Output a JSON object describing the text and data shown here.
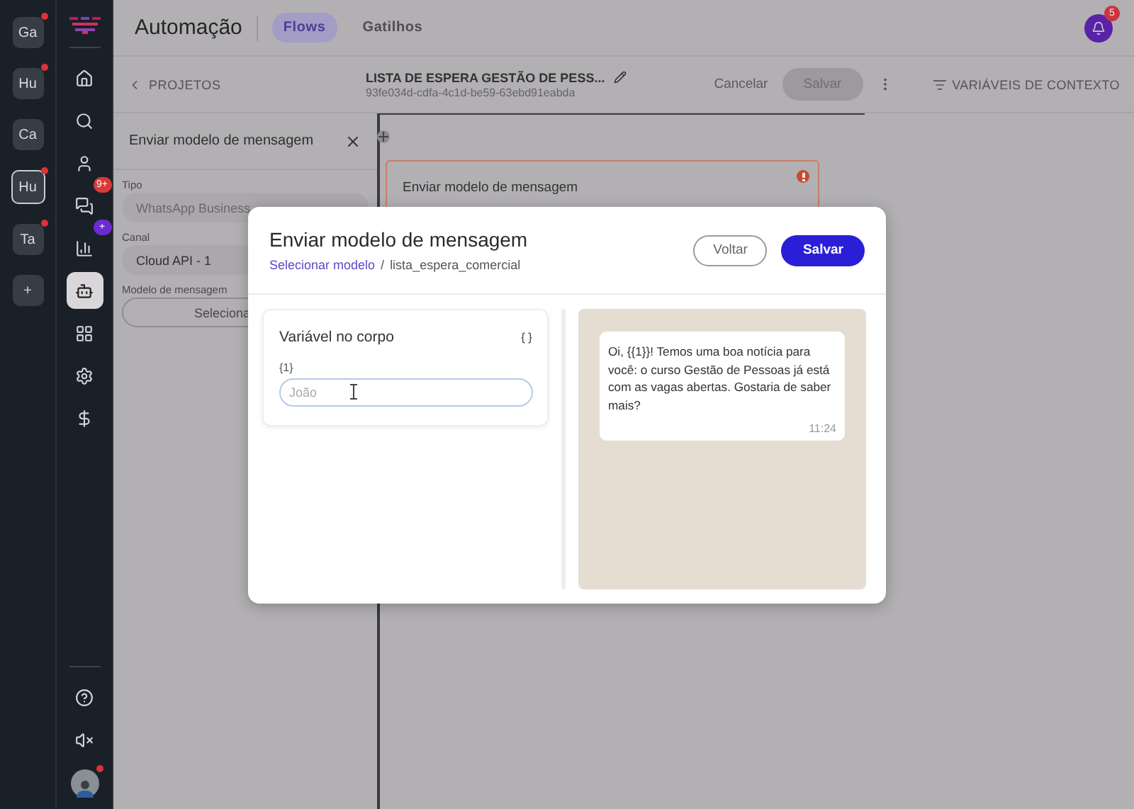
{
  "workspaces": [
    {
      "label": "Ga",
      "selected": false,
      "notification": true
    },
    {
      "label": "Hu",
      "selected": false,
      "notification": true
    },
    {
      "label": "Ca",
      "selected": false,
      "notification": false
    },
    {
      "label": "Hu",
      "selected": true,
      "notification": true
    },
    {
      "label": "Ta",
      "selected": false,
      "notification": true
    }
  ],
  "add_workspace": "+",
  "nav_items": [
    {
      "selected": false
    },
    {
      "selected": false
    },
    {
      "selected": false
    },
    {
      "selected": false,
      "badge": "9+",
      "color": "#d93a3a"
    },
    {
      "selected": false,
      "badge": "+",
      "color": "#6a2bd0"
    },
    {
      "selected": true
    },
    {
      "selected": false
    },
    {
      "selected": false
    },
    {
      "selected": false
    }
  ],
  "nav_bottom": {
    "avatar_notification": true
  },
  "header": {
    "title": "Automação",
    "tabs": [
      {
        "label": "Flows",
        "selected": true
      },
      {
        "label": "Gatilhos",
        "selected": false
      }
    ],
    "notifications": "5"
  },
  "toolbar": {
    "back": "PROJETOS",
    "flow_name": "LISTA DE ESPERA GESTÃO DE PESS...",
    "flow_id": "93fe034d-cdfa-4c1d-be59-63ebd91eabda",
    "cancel": "Cancelar",
    "save": {
      "label": "Salvar",
      "disabled": true
    },
    "context_variables": "VARIÁVEIS DE CONTEXTO"
  },
  "side_panel": {
    "title": "Enviar modelo de mensagem",
    "fields": [
      {
        "label": "Tipo",
        "value": "WhatsApp Business",
        "disabled": true
      },
      {
        "label": "Canal",
        "value": "Cloud API - 1",
        "disabled": false
      }
    ],
    "template": {
      "label": "Modelo de mensagem",
      "button": "Seleciona"
    }
  },
  "canvas": {
    "node": {
      "title": "Enviar modelo de mensagem",
      "error": true
    }
  },
  "modal": {
    "title": "Enviar modelo de mensagem",
    "breadcrumb": [
      {
        "label": "Selecionar modelo",
        "link": true
      },
      {
        "label": "lista_espera_comercial",
        "link": false
      }
    ],
    "breadcrumb_separator": "/",
    "buttons": [
      {
        "label": "Voltar",
        "kind": "outline"
      },
      {
        "label": "Salvar",
        "kind": "primary"
      }
    ],
    "variables": {
      "title": "Variável no corpo",
      "fields": [
        {
          "label": "{1}",
          "placeholder": "João",
          "focused": true
        }
      ]
    },
    "preview": {
      "message": "Oi, {{1}}! Temos uma boa notícia para você: o curso Gestão de Pessoas já está com as vagas abertas. Gostaria de saber mais?",
      "time": "11:24"
    }
  }
}
